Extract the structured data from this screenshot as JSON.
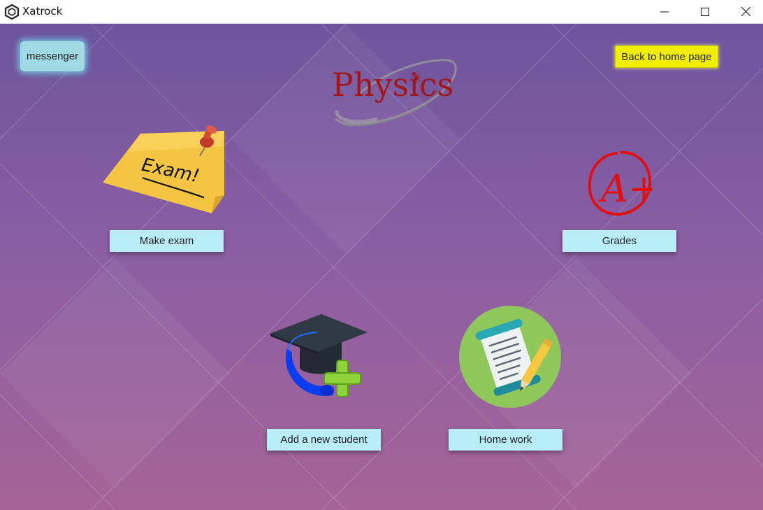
{
  "window": {
    "title": "Xatrock",
    "controls": [
      "minimize-icon",
      "maximize-icon",
      "close-icon"
    ]
  },
  "header": {
    "messenger_label": "messenger",
    "home_label": "Back to home page",
    "logo_text": "Physics"
  },
  "notes": {
    "exam_note_text": "Exam!",
    "grade_text": "A+"
  },
  "actions": {
    "make_exam_label": "Make exam",
    "grades_label": "Grades",
    "add_student_label": "Add a new student",
    "homework_label": "Home work"
  },
  "colors": {
    "background_top": "#6d559d",
    "background_bottom": "#a56497",
    "action_button": "#b8ecf7",
    "home_button": "#f2ee00",
    "logo": "#a3161a"
  }
}
